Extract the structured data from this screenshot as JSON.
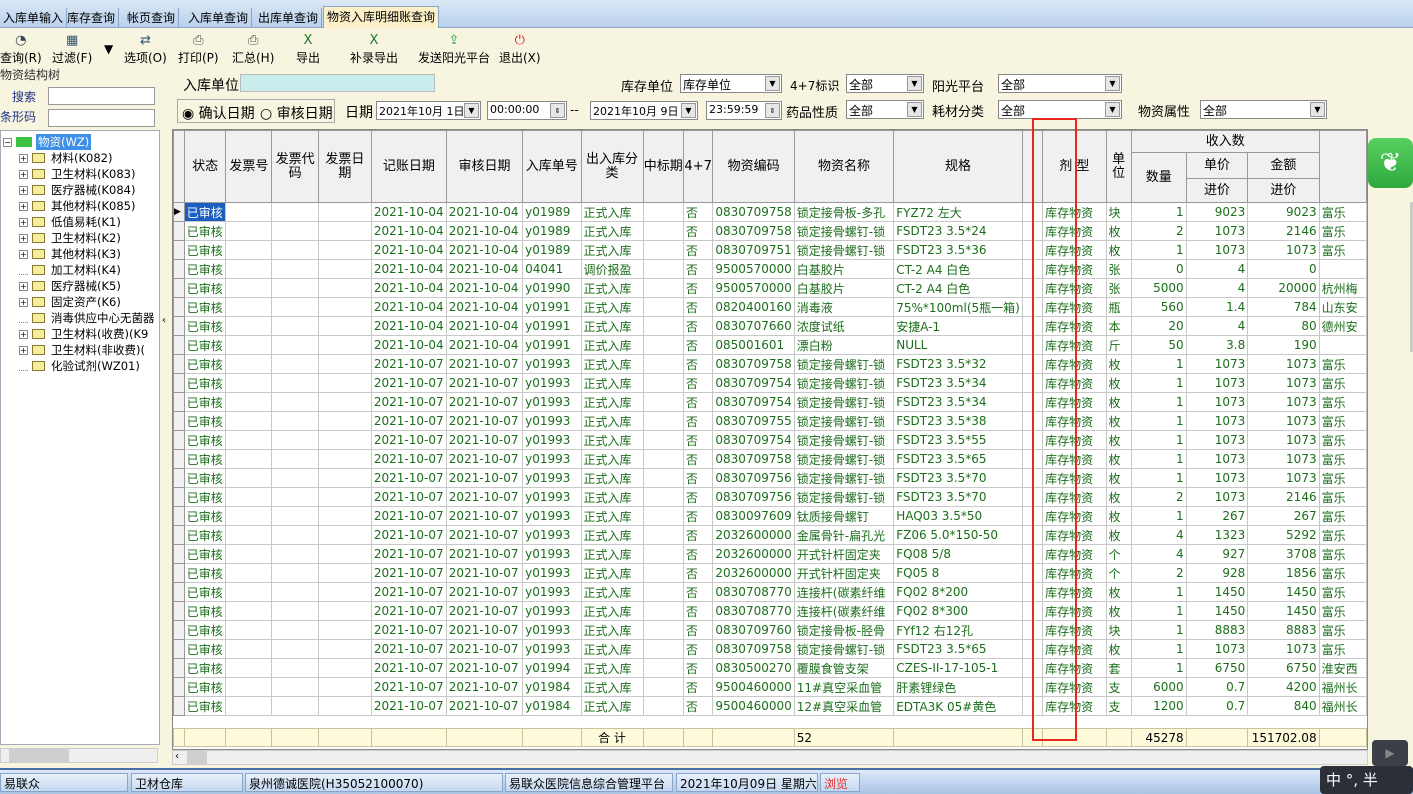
{
  "tabs": [
    "入库单输入",
    "库存查询",
    "帐页查询",
    "入库单查询",
    "出库单查询",
    "物资入库明细账查询"
  ],
  "active_tab": 5,
  "toolbar": [
    {
      "label": "查询(R)",
      "icon": "refresh-icon"
    },
    {
      "label": "过滤(F)",
      "icon": "filter-icon"
    },
    {
      "label": "选项(O)",
      "icon": "options-icon"
    },
    {
      "label": "打印(P)",
      "icon": "print-icon"
    },
    {
      "label": "汇总(H)",
      "icon": "summary-print-icon"
    },
    {
      "label": "导出",
      "icon": "excel-export-icon"
    },
    {
      "label": "补录导出",
      "icon": "excel-supplement-export-icon"
    },
    {
      "label": "发送阳光平台",
      "icon": "send-upload-icon"
    },
    {
      "label": "退出(X)",
      "icon": "power-exit-icon"
    }
  ],
  "left_panel": {
    "title": "物资结构树",
    "search_label": "搜索",
    "barcode_label": "条形码",
    "search_value": "",
    "barcode_value": "",
    "root": "物资(WZ)",
    "nodes": [
      {
        "label": "材料(K082)",
        "expandable": true
      },
      {
        "label": "卫生材料(K083)",
        "expandable": true
      },
      {
        "label": "医疗器械(K084)",
        "expandable": true
      },
      {
        "label": "其他材料(K085)",
        "expandable": true
      },
      {
        "label": "低值易耗(K1)",
        "expandable": true
      },
      {
        "label": "卫生材料(K2)",
        "expandable": true
      },
      {
        "label": "其他材料(K3)",
        "expandable": true
      },
      {
        "label": "加工材料(K4)",
        "expandable": false
      },
      {
        "label": "医疗器械(K5)",
        "expandable": true
      },
      {
        "label": "固定资产(K6)",
        "expandable": true
      },
      {
        "label": "消毒供应中心无菌器",
        "expandable": false
      },
      {
        "label": "卫生材料(收费)(K9",
        "expandable": true
      },
      {
        "label": "卫生材料(非收费)(",
        "expandable": true
      },
      {
        "label": "化验试剂(WZ01)",
        "expandable": false
      }
    ]
  },
  "filters": {
    "in_unit_label": "入库单位",
    "in_unit_value": "",
    "stock_unit_label": "库存单位",
    "stock_unit_value": "库存单位",
    "tag47_label": "4+7标识",
    "tag47_value": "全部",
    "sun_label": "阳光平台",
    "sun_value": "全部",
    "radio_confirm": "确认日期",
    "radio_audit": "审核日期",
    "radio_selected": "确认日期",
    "date_label": "日期",
    "date_from": "2021年10月 1日",
    "time_from": "00:00:00",
    "sep": "--",
    "date_to": "2021年10月 9日",
    "time_to": "23:59:59",
    "drug_label": "药品性质",
    "drug_value": "全部",
    "cons_label": "耗材分类",
    "cons_value": "全部",
    "attr_label": "物资属性",
    "attr_value": "全部"
  },
  "grid": {
    "headers": [
      "状态",
      "发票号",
      "发票代码",
      "发票日期",
      "记账日期",
      "审核日期",
      "入库单号",
      "出入库分类",
      "中标期",
      "4+7",
      "物资编码",
      "物资名称",
      "规格",
      "",
      "剂 型",
      "单位"
    ],
    "group_header": "收入数",
    "qty_header": "数量",
    "price_header": "单价",
    "price_sub": "进价",
    "amount_header": "金额",
    "amount_sub": "进价",
    "rows": [
      [
        "已审核",
        "",
        "",
        "",
        "2021-10-04",
        "2021-10-04",
        "y01989",
        "正式入库",
        "",
        "否",
        "0830709758",
        "锁定接骨板-多孔",
        "FYZ72  左大",
        "",
        "库存物资",
        "块",
        "1",
        "9023",
        "9023",
        "富乐"
      ],
      [
        "已审核",
        "",
        "",
        "",
        "2021-10-04",
        "2021-10-04",
        "y01989",
        "正式入库",
        "",
        "否",
        "0830709758",
        "锁定接骨螺钉-锁",
        "FSDT23  3.5*24",
        "",
        "库存物资",
        "枚",
        "2",
        "1073",
        "2146",
        "富乐"
      ],
      [
        "已审核",
        "",
        "",
        "",
        "2021-10-04",
        "2021-10-04",
        "y01989",
        "正式入库",
        "",
        "否",
        "0830709751",
        "锁定接骨螺钉-锁",
        "FSDT23  3.5*36",
        "",
        "库存物资",
        "枚",
        "1",
        "1073",
        "1073",
        "富乐"
      ],
      [
        "已审核",
        "",
        "",
        "",
        "2021-10-04",
        "2021-10-04",
        "04041",
        "调价报盈",
        "",
        "否",
        "9500570000",
        "白基胶片",
        "CT-2  A4  白色",
        "",
        "库存物资",
        "张",
        "0",
        "4",
        "0",
        ""
      ],
      [
        "已审核",
        "",
        "",
        "",
        "2021-10-04",
        "2021-10-04",
        "y01990",
        "正式入库",
        "",
        "否",
        "9500570000",
        "白基胶片",
        "CT-2  A4  白色",
        "",
        "库存物资",
        "张",
        "5000",
        "4",
        "20000",
        "杭州梅"
      ],
      [
        "已审核",
        "",
        "",
        "",
        "2021-10-04",
        "2021-10-04",
        "y01991",
        "正式入库",
        "",
        "否",
        "0820400160",
        "消毒液",
        "75%*100ml(5瓶一箱)",
        "",
        "库存物资",
        "瓶",
        "560",
        "1.4",
        "784",
        "山东安"
      ],
      [
        "已审核",
        "",
        "",
        "",
        "2021-10-04",
        "2021-10-04",
        "y01991",
        "正式入库",
        "",
        "否",
        "0830707660",
        "浓度试纸",
        "安捷A-1",
        "",
        "库存物资",
        "本",
        "20",
        "4",
        "80",
        "德州安"
      ],
      [
        "已审核",
        "",
        "",
        "",
        "2021-10-04",
        "2021-10-04",
        "y01991",
        "正式入库",
        "",
        "否",
        "085001601",
        "漂白粉",
        "NULL",
        "",
        "库存物资",
        "斤",
        "50",
        "3.8",
        "190",
        ""
      ],
      [
        "已审核",
        "",
        "",
        "",
        "2021-10-07",
        "2021-10-07",
        "y01993",
        "正式入库",
        "",
        "否",
        "0830709758",
        "锁定接骨螺钉-锁",
        "FSDT23  3.5*32",
        "",
        "库存物资",
        "枚",
        "1",
        "1073",
        "1073",
        "富乐"
      ],
      [
        "已审核",
        "",
        "",
        "",
        "2021-10-07",
        "2021-10-07",
        "y01993",
        "正式入库",
        "",
        "否",
        "0830709754",
        "锁定接骨螺钉-锁",
        "FSDT23  3.5*34",
        "",
        "库存物资",
        "枚",
        "1",
        "1073",
        "1073",
        "富乐"
      ],
      [
        "已审核",
        "",
        "",
        "",
        "2021-10-07",
        "2021-10-07",
        "y01993",
        "正式入库",
        "",
        "否",
        "0830709754",
        "锁定接骨螺钉-锁",
        "FSDT23  3.5*34",
        "",
        "库存物资",
        "枚",
        "1",
        "1073",
        "1073",
        "富乐"
      ],
      [
        "已审核",
        "",
        "",
        "",
        "2021-10-07",
        "2021-10-07",
        "y01993",
        "正式入库",
        "",
        "否",
        "0830709755",
        "锁定接骨螺钉-锁",
        "FSDT23  3.5*38",
        "",
        "库存物资",
        "枚",
        "1",
        "1073",
        "1073",
        "富乐"
      ],
      [
        "已审核",
        "",
        "",
        "",
        "2021-10-07",
        "2021-10-07",
        "y01993",
        "正式入库",
        "",
        "否",
        "0830709754",
        "锁定接骨螺钉-锁",
        "FSDT23  3.5*55",
        "",
        "库存物资",
        "枚",
        "1",
        "1073",
        "1073",
        "富乐"
      ],
      [
        "已审核",
        "",
        "",
        "",
        "2021-10-07",
        "2021-10-07",
        "y01993",
        "正式入库",
        "",
        "否",
        "0830709758",
        "锁定接骨螺钉-锁",
        "FSDT23  3.5*65",
        "",
        "库存物资",
        "枚",
        "1",
        "1073",
        "1073",
        "富乐"
      ],
      [
        "已审核",
        "",
        "",
        "",
        "2021-10-07",
        "2021-10-07",
        "y01993",
        "正式入库",
        "",
        "否",
        "0830709756",
        "锁定接骨螺钉-锁",
        "FSDT23  3.5*70",
        "",
        "库存物资",
        "枚",
        "1",
        "1073",
        "1073",
        "富乐"
      ],
      [
        "已审核",
        "",
        "",
        "",
        "2021-10-07",
        "2021-10-07",
        "y01993",
        "正式入库",
        "",
        "否",
        "0830709756",
        "锁定接骨螺钉-锁",
        "FSDT23  3.5*70",
        "",
        "库存物资",
        "枚",
        "2",
        "1073",
        "2146",
        "富乐"
      ],
      [
        "已审核",
        "",
        "",
        "",
        "2021-10-07",
        "2021-10-07",
        "y01993",
        "正式入库",
        "",
        "否",
        "0830097609",
        "钛质接骨螺钉",
        "HAQ03 3.5*50",
        "",
        "库存物资",
        "枚",
        "1",
        "267",
        "267",
        "富乐"
      ],
      [
        "已审核",
        "",
        "",
        "",
        "2021-10-07",
        "2021-10-07",
        "y01993",
        "正式入库",
        "",
        "否",
        "2032600000",
        "金属骨针-扁孔光",
        "FZ06 5.0*150-50",
        "",
        "库存物资",
        "枚",
        "4",
        "1323",
        "5292",
        "富乐"
      ],
      [
        "已审核",
        "",
        "",
        "",
        "2021-10-07",
        "2021-10-07",
        "y01993",
        "正式入库",
        "",
        "否",
        "2032600000",
        "开式针杆固定夹",
        "FQ08  5/8",
        "",
        "库存物资",
        "个",
        "4",
        "927",
        "3708",
        "富乐"
      ],
      [
        "已审核",
        "",
        "",
        "",
        "2021-10-07",
        "2021-10-07",
        "y01993",
        "正式入库",
        "",
        "否",
        "2032600000",
        "开式针杆固定夹",
        "FQ05  8",
        "",
        "库存物资",
        "个",
        "2",
        "928",
        "1856",
        "富乐"
      ],
      [
        "已审核",
        "",
        "",
        "",
        "2021-10-07",
        "2021-10-07",
        "y01993",
        "正式入库",
        "",
        "否",
        "0830708770",
        "连接杆(碳素纤维",
        "FQ02  8*200",
        "",
        "库存物资",
        "枚",
        "1",
        "1450",
        "1450",
        "富乐"
      ],
      [
        "已审核",
        "",
        "",
        "",
        "2021-10-07",
        "2021-10-07",
        "y01993",
        "正式入库",
        "",
        "否",
        "0830708770",
        "连接杆(碳素纤维",
        "FQ02  8*300",
        "",
        "库存物资",
        "枚",
        "1",
        "1450",
        "1450",
        "富乐"
      ],
      [
        "已审核",
        "",
        "",
        "",
        "2021-10-07",
        "2021-10-07",
        "y01993",
        "正式入库",
        "",
        "否",
        "0830709760",
        "锁定接骨板-胫骨",
        "FYf12  右12孔",
        "",
        "库存物资",
        "块",
        "1",
        "8883",
        "8883",
        "富乐"
      ],
      [
        "已审核",
        "",
        "",
        "",
        "2021-10-07",
        "2021-10-07",
        "y01993",
        "正式入库",
        "",
        "否",
        "0830709758",
        "锁定接骨螺钉-锁",
        "FSDT23  3.5*65",
        "",
        "库存物资",
        "枚",
        "1",
        "1073",
        "1073",
        "富乐"
      ],
      [
        "已审核",
        "",
        "",
        "",
        "2021-10-07",
        "2021-10-07",
        "y01994",
        "正式入库",
        "",
        "否",
        "0830500270",
        "覆膜食管支架",
        "CZES-II-17-105-1",
        "",
        "库存物资",
        "套",
        "1",
        "6750",
        "6750",
        "淮安西"
      ],
      [
        "已审核",
        "",
        "",
        "",
        "2021-10-07",
        "2021-10-07",
        "y01984",
        "正式入库",
        "",
        "否",
        "9500460000",
        "11#真空采血管",
        "肝素锂绿色",
        "",
        "库存物资",
        "支",
        "6000",
        "0.7",
        "4200",
        "福州长"
      ],
      [
        "已审核",
        "",
        "",
        "",
        "2021-10-07",
        "2021-10-07",
        "y01984",
        "正式入库",
        "",
        "否",
        "9500460000",
        "12#真空采血管",
        "EDTA3K 05#黄色",
        "",
        "库存物资",
        "支",
        "1200",
        "0.7",
        "840",
        "福州长"
      ]
    ],
    "total": {
      "label": "合  计",
      "count": "52",
      "qty": "45278",
      "amount": "151702.08"
    }
  },
  "status_bar": [
    "易联众",
    "卫材仓库",
    "泉州德诚医院(H35052100070)",
    "易联众医院信息综合管理平台",
    "2021年10月09日 星期六",
    "浏览"
  ],
  "ime": "中 °, 半",
  "colors": {
    "grid_text": "#1c6e1c",
    "highlight": "#1c5fc0",
    "annotation": "#e8281c",
    "status_alert": "#e0302a"
  }
}
